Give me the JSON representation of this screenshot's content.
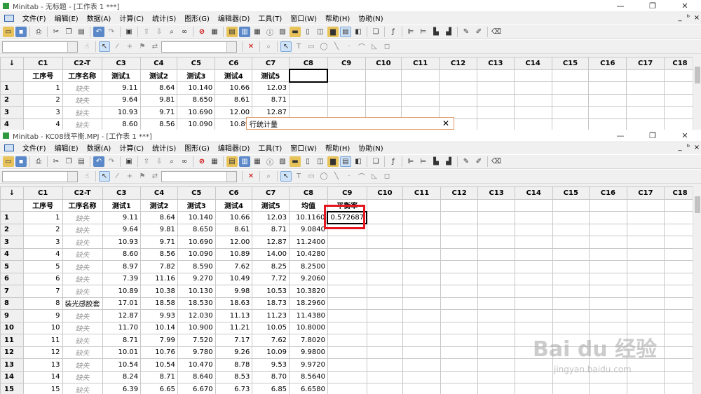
{
  "top_window": {
    "title": "Minitab - 无标题 - [工作表 1 ***]"
  },
  "bottom_window": {
    "title": "Minitab - KC08线平衡.MPJ - [工作表 1 ***]"
  },
  "menu": [
    "文件(F)",
    "编辑(E)",
    "数据(A)",
    "计算(C)",
    "统计(S)",
    "图形(G)",
    "编辑器(D)",
    "工具(T)",
    "窗口(W)",
    "帮助(H)",
    "协助(N)"
  ],
  "winctl": [
    "—",
    "❐",
    "✕"
  ],
  "childctl": [
    "_",
    "ᵇ",
    "×"
  ],
  "sheet_arrow": "↓",
  "columns": [
    "C1",
    "C2-T",
    "C3",
    "C4",
    "C5",
    "C6",
    "C7",
    "C8",
    "C9",
    "C10",
    "C11",
    "C12",
    "C13",
    "C14",
    "C15",
    "C16",
    "C17",
    "C18"
  ],
  "top_names": [
    "工序号",
    "工序名称",
    "测试1",
    "测试2",
    "测试3",
    "测试4",
    "测试5",
    "",
    "",
    "",
    "",
    "",
    "",
    "",
    "",
    "",
    "",
    ""
  ],
  "bottom_names": [
    "工序号",
    "工序名称",
    "测试1",
    "测试2",
    "测试3",
    "测试4",
    "测试5",
    "均值",
    "平衡率",
    "",
    "",
    "",
    "",
    "",
    "",
    "",
    "",
    ""
  ],
  "top_rows": [
    [
      "1",
      "1",
      "缺失",
      "9.11",
      "8.64",
      "10.140",
      "10.66",
      "12.03"
    ],
    [
      "2",
      "2",
      "缺失",
      "9.64",
      "9.81",
      "8.650",
      "8.61",
      "8.71"
    ],
    [
      "3",
      "3",
      "缺失",
      "10.93",
      "9.71",
      "10.690",
      "12.00",
      "12.87"
    ],
    [
      "4",
      "4",
      "缺失",
      "8.60",
      "8.56",
      "10.090",
      "10.89",
      ""
    ]
  ],
  "bottom_rows": [
    [
      "1",
      "1",
      "缺失",
      "9.11",
      "8.64",
      "10.140",
      "10.66",
      "12.03",
      "10.1160",
      "0.572687"
    ],
    [
      "2",
      "2",
      "缺失",
      "9.64",
      "9.81",
      "8.650",
      "8.61",
      "8.71",
      "9.0840",
      ""
    ],
    [
      "3",
      "3",
      "缺失",
      "10.93",
      "9.71",
      "10.690",
      "12.00",
      "12.87",
      "11.2400",
      ""
    ],
    [
      "4",
      "4",
      "缺失",
      "8.60",
      "8.56",
      "10.090",
      "10.89",
      "14.00",
      "10.4280",
      ""
    ],
    [
      "5",
      "5",
      "缺失",
      "8.97",
      "7.82",
      "8.590",
      "7.62",
      "8.25",
      "8.2500",
      ""
    ],
    [
      "6",
      "6",
      "缺失",
      "7.39",
      "11.16",
      "9.270",
      "10.49",
      "7.72",
      "9.2060",
      ""
    ],
    [
      "7",
      "7",
      "缺失",
      "10.89",
      "10.38",
      "10.130",
      "9.98",
      "10.53",
      "10.3820",
      ""
    ],
    [
      "8",
      "8",
      "装光感胶套",
      "17.01",
      "18.58",
      "18.530",
      "18.63",
      "18.73",
      "18.2960",
      ""
    ],
    [
      "9",
      "9",
      "缺失",
      "12.87",
      "9.93",
      "12.030",
      "11.13",
      "11.23",
      "11.4380",
      ""
    ],
    [
      "10",
      "10",
      "缺失",
      "11.70",
      "10.14",
      "10.900",
      "11.21",
      "10.05",
      "10.8000",
      ""
    ],
    [
      "11",
      "11",
      "缺失",
      "8.71",
      "7.99",
      "7.520",
      "7.17",
      "7.62",
      "7.8020",
      ""
    ],
    [
      "12",
      "12",
      "缺失",
      "10.01",
      "10.76",
      "9.780",
      "9.26",
      "10.09",
      "9.9800",
      ""
    ],
    [
      "13",
      "13",
      "缺失",
      "10.54",
      "10.54",
      "10.470",
      "8.78",
      "9.53",
      "9.9720",
      ""
    ],
    [
      "14",
      "14",
      "缺失",
      "8.24",
      "8.71",
      "8.640",
      "8.53",
      "8.70",
      "8.5640",
      ""
    ],
    [
      "15",
      "15",
      "缺失",
      "6.39",
      "6.65",
      "6.670",
      "6.73",
      "6.85",
      "6.6580",
      ""
    ]
  ],
  "dialog": {
    "title": "行统计量",
    "close": "✕"
  },
  "watermark": {
    "brand": "Bai du 经验",
    "url": "jingyan.baidu.com"
  },
  "toolbar_icons": [
    "open-icon",
    "save-icon",
    "print-icon",
    "cut-icon",
    "copy-icon",
    "paste-icon",
    "undo-icon",
    "redo-icon",
    "sheet-icon",
    "up-icon",
    "down-icon",
    "find-icon",
    "stop-icon",
    "calc-icon"
  ]
}
